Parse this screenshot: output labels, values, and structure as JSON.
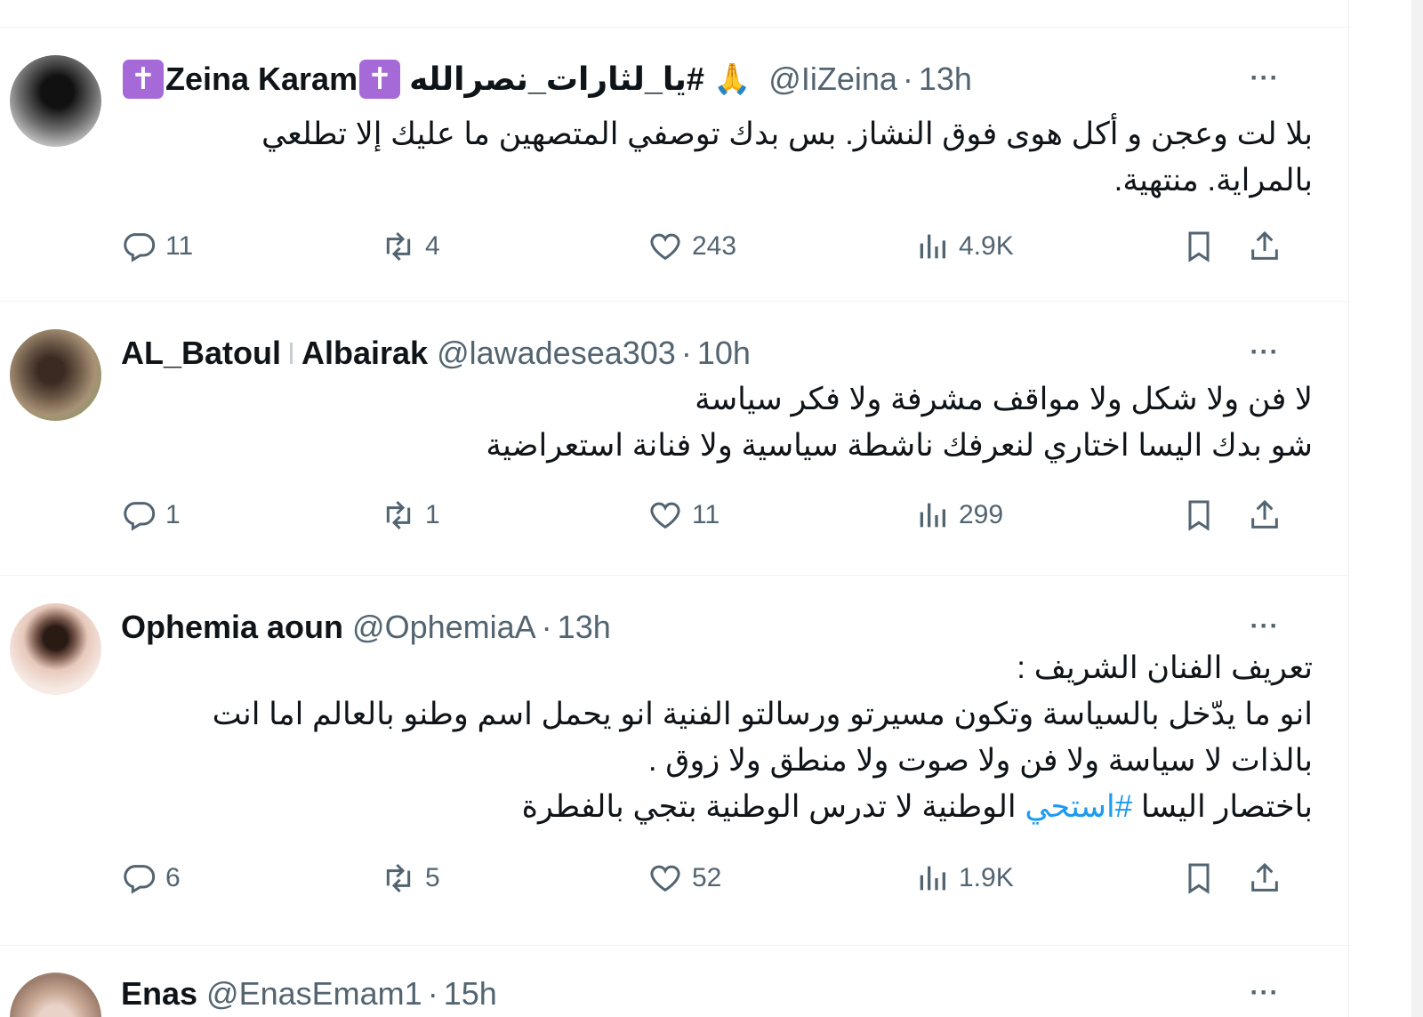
{
  "tweets": [
    {
      "name_prefix_icon": "latin-cross-icon",
      "name": "Zeina Karam",
      "name_suffix_icon": "latin-cross-icon",
      "hashtag": "#يا_لثارات_نصرالله",
      "emoji": "🙏",
      "handle": "@IiZeina",
      "dot": "·",
      "time": "13h",
      "more": "···",
      "lines": [
        "بلا لت وعجن و أكل هوى فوق النشاز. بس بدك توصفي المتصهين ما عليك إلا تطلعي",
        "بالمراية. منتهية."
      ],
      "replies": "11",
      "retweets": "4",
      "likes": "243",
      "views": "4.9K"
    },
    {
      "name_a": "AL_Batoul",
      "name_b": "Albairak",
      "handle": "@lawadesea303",
      "dot": "·",
      "time": "10h",
      "more": "···",
      "lines": [
        "لا فن ولا شكل ولا مواقف مشرفة ولا فكر سياسة",
        "شو بدك اليسا اختاري لنعرفك ناشطة سياسية ولا فنانة استعراضية"
      ],
      "replies": "1",
      "retweets": "1",
      "likes": "11",
      "views": "299"
    },
    {
      "name": "Ophemia aoun",
      "handle": "@OphemiaA",
      "dot": "·",
      "time": "13h",
      "more": "···",
      "lines": [
        "تعريف الفنان الشريف :",
        "انو ما يدّخل بالسياسة وتكون مسيرتو ورسالتو الفنية انو يحمل اسم وطنو بالعالم اما انت",
        "بالذات لا سياسة ولا فن ولا صوت ولا منطق ولا زوق ."
      ],
      "last_line_start": "باختصار اليسا ",
      "last_line_hashtag": "#استحي",
      "last_line_end": " الوطنية لا تدرس الوطنية بتجي بالفطرة",
      "replies": "6",
      "retweets": "5",
      "likes": "52",
      "views": "1.9K"
    },
    {
      "name": "Enas",
      "handle": "@EnasEmam1",
      "dot": "·",
      "time": "15h",
      "more": "···"
    }
  ],
  "colors": {
    "text": "#0f1419",
    "secondary": "#536471",
    "link": "#1d9bf0",
    "badge": "#a66ad8",
    "divider": "#eff3f4"
  }
}
